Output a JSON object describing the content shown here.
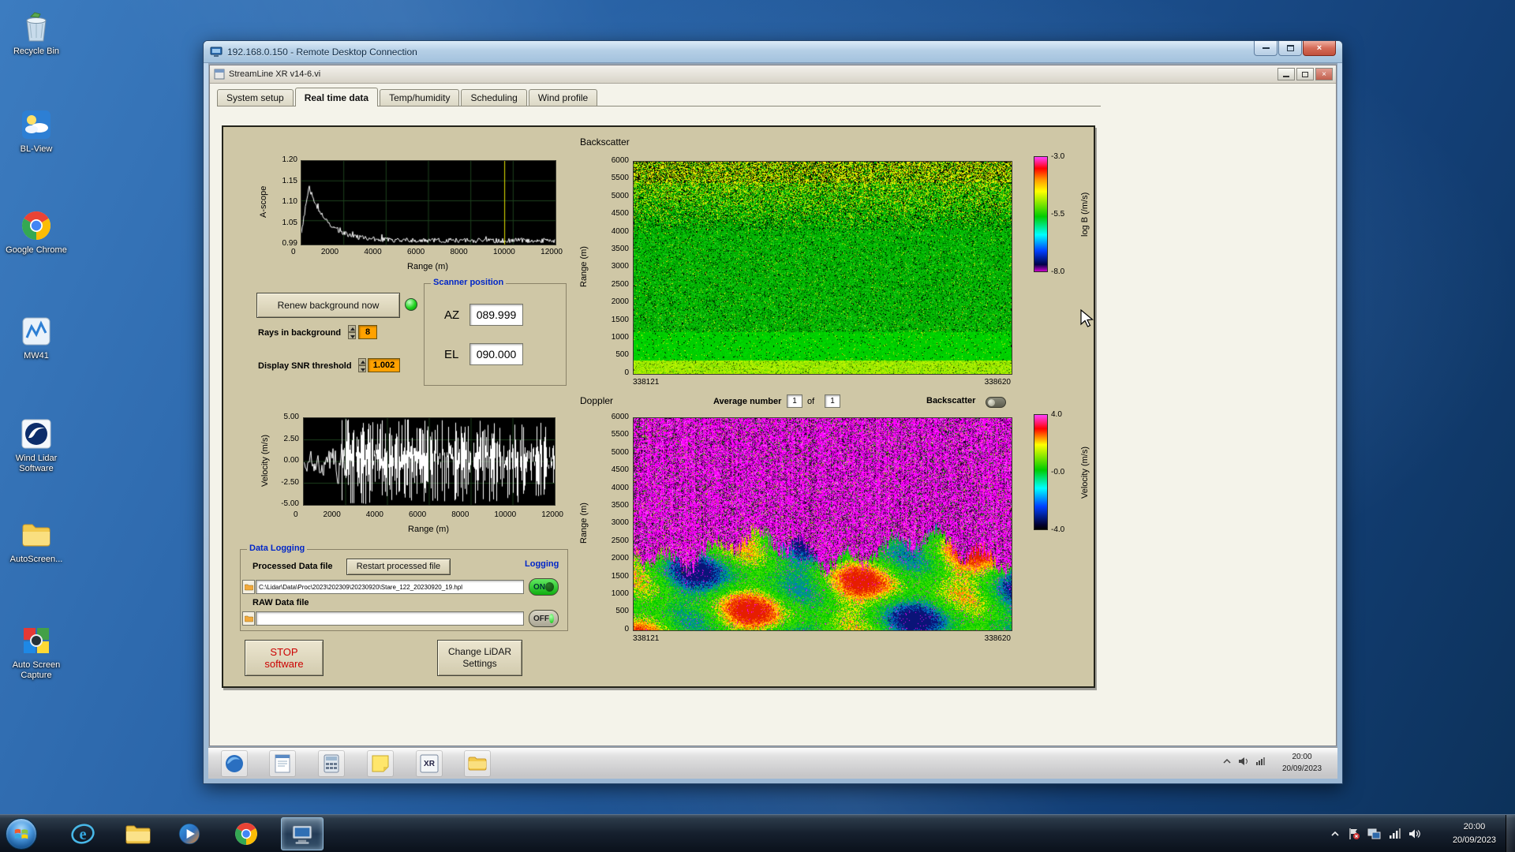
{
  "desktop": {
    "icons": [
      {
        "name": "recycle-bin",
        "label": "Recycle Bin"
      },
      {
        "name": "bl-view",
        "label": "BL-View"
      },
      {
        "name": "google-chrome",
        "label": "Google Chrome"
      },
      {
        "name": "mw41",
        "label": "MW41"
      },
      {
        "name": "wind-lidar",
        "label": "Wind Lidar Software"
      },
      {
        "name": "autoscreen",
        "label": "AutoScreen..."
      },
      {
        "name": "auto-screen-capture",
        "label": "Auto Screen Capture"
      }
    ]
  },
  "rdp_window": {
    "title": "192.168.0.150 - Remote Desktop Connection"
  },
  "app_window": {
    "title": "StreamLine XR v14-6.vi",
    "tabs": [
      {
        "label": "System setup",
        "active": false
      },
      {
        "label": "Real time data",
        "active": true
      },
      {
        "label": "Temp/humidity",
        "active": false
      },
      {
        "label": "Scheduling",
        "active": false
      },
      {
        "label": "Wind profile",
        "active": false
      }
    ]
  },
  "panel": {
    "backscatter_title": "Backscatter",
    "doppler_title": "Doppler",
    "renew_button": "Renew background now",
    "rays_label": "Rays in background",
    "rays_value": "8",
    "snr_label": "Display SNR threshold",
    "snr_value": "1.002",
    "scanner": {
      "title": "Scanner position",
      "az_label": "AZ",
      "az_value": "089.999",
      "el_label": "EL",
      "el_value": "090.000"
    },
    "average": {
      "label": "Average number",
      "value": "1",
      "of_label": "of",
      "total": "1"
    },
    "backscatter_toggle_label": "Backscatter",
    "data_logging": {
      "title": "Data Logging",
      "processed_label": "Processed Data file",
      "restart_button": "Restart processed file",
      "logging_label": "Logging",
      "processed_path": "C:\\Lidar\\Data\\Proc\\2023\\202309\\20230920\\Stare_122_20230920_19.hpl",
      "on_label": "ON",
      "raw_label": "RAW Data file",
      "raw_path": "",
      "off_label": "OFF"
    },
    "stop_button_line1": "STOP",
    "stop_button_line2": "software",
    "settings_button_line1": "Change LiDAR",
    "settings_button_line2": "Settings"
  },
  "remote_taskbar": {
    "xr_icon_label": "XR",
    "clock_time": "20:00",
    "clock_date": "20/09/2023"
  },
  "taskbar": {
    "clock_time": "20:00",
    "clock_date": "20/09/2023"
  },
  "colors": {
    "panel_bg": "#cfc7a6",
    "lv_orange": "#ffa200",
    "led_green": "#1ed21e",
    "toggle_on_green": "#0fae0f"
  },
  "chart_data": [
    {
      "id": "ascope",
      "type": "line",
      "title": "A-scope background trace",
      "xlabel": "Range (m)",
      "ylabel": "A-scope",
      "xlim": [
        0,
        12000
      ],
      "ylim": [
        0.99,
        1.2
      ],
      "xtick_labels": [
        "0",
        "2000",
        "4000",
        "6000",
        "8000",
        "10000",
        "12000"
      ],
      "ytick_labels": [
        "1.20",
        "1.15",
        "1.10",
        "1.05",
        "0.99"
      ],
      "bg": "#000000",
      "grid_color": "#1d421d",
      "line_color": "#ffffff",
      "cursor_x": 9600,
      "cursor_color": "#e8e800",
      "shape": "peak ~1.14 near 400 m decaying to ~1.00 by 3000 m, flat noisy ~1.00 out to 12000 m"
    },
    {
      "id": "backscatter",
      "type": "heatmap",
      "title": "Backscatter",
      "ylabel": "Range (m)",
      "ylim": [
        0,
        6000
      ],
      "ytick_labels": [
        "6000",
        "5500",
        "5000",
        "4500",
        "4000",
        "3500",
        "3000",
        "2500",
        "2000",
        "1500",
        "1000",
        "500",
        "0"
      ],
      "x_start_label": "338121",
      "x_end_label": "338620",
      "colorbar": {
        "label": "log B (/m/s)",
        "ticks": [
          "-3.0",
          "-5.5",
          "-8.0"
        ],
        "colors": [
          "#ff40ff 0%",
          "#ff0000 10%",
          "#ff9800 20%",
          "#ffff00 30%",
          "#00cc00 52%",
          "#00ffff 68%",
          "#0040ff 82%",
          "#000048 94%",
          "#cc00cc 100%"
        ]
      },
      "description": "yellow/black speckle noise above ~4500 m over green noise field; brighter solid green below ~2500 m and bright green-yellow surface layer below ~400 m"
    },
    {
      "id": "velocity",
      "type": "line",
      "title": "Doppler velocity trace",
      "xlabel": "Range (m)",
      "ylabel": "Velocity (m/s)",
      "xlim": [
        0,
        12000
      ],
      "ylim": [
        -5,
        5
      ],
      "xtick_labels": [
        "0",
        "2000",
        "4000",
        "6000",
        "8000",
        "10000",
        "12000"
      ],
      "ytick_labels": [
        "5.00",
        "2.50",
        "0.00",
        "-2.50",
        "-5.00"
      ],
      "bg": "#000000",
      "grid_color": "#1d421d",
      "line_color": "#ffffff",
      "shape": "coherent trace near 0 m/s out to ~1800 m, uncorrelated full-scale noise bars beyond"
    },
    {
      "id": "doppler",
      "type": "heatmap",
      "title": "Doppler",
      "ylabel": "Range (m)",
      "ylim": [
        0,
        6000
      ],
      "ytick_labels": [
        "6000",
        "5500",
        "5000",
        "4500",
        "4000",
        "3500",
        "3000",
        "2500",
        "2000",
        "1500",
        "1000",
        "500",
        "0"
      ],
      "x_start_label": "338121",
      "x_end_label": "338620",
      "colorbar": {
        "label": "Velocity (m/s)",
        "ticks": [
          "4.0",
          "-0.0",
          "-4.0"
        ],
        "colors": [
          "#ff40ff 0%",
          "#ff0000 12%",
          "#ffff00 26%",
          "#00cc00 48%",
          "#00ffff 64%",
          "#0040ff 80%",
          "#000030 96%",
          "#000000 100%"
        ]
      },
      "description": "magenta velocity noise above ~2000 m with vertical streaking; coherent green/yellow/red/blue aerosol returns below ~2000 m"
    }
  ]
}
